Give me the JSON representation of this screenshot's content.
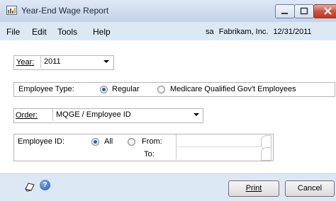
{
  "window": {
    "title": "Year-End Wage Report"
  },
  "menu": {
    "items": [
      "File",
      "Edit",
      "Tools",
      "Help"
    ]
  },
  "status": {
    "user": "sa",
    "company": "Fabrikam, Inc.",
    "date": "12/31/2011"
  },
  "year": {
    "label": "Year:",
    "value": "2011"
  },
  "employee_type": {
    "label": "Employee Type:",
    "options": [
      "Regular",
      "Medicare Qualified Gov't Employees"
    ],
    "selected": "Regular"
  },
  "order": {
    "label": "Order:",
    "value": "MQGE / Employee ID"
  },
  "employee_id": {
    "label": "Employee ID:",
    "option_all": "All",
    "option_from": "From:",
    "to_label": "To:",
    "selected": "All",
    "from_value": "",
    "to_value": ""
  },
  "buttons": {
    "print": "Print",
    "cancel": "Cancel"
  },
  "icons": {
    "app": "report-icon",
    "note": "note-icon",
    "help": "help-icon",
    "help_glyph": "?"
  }
}
